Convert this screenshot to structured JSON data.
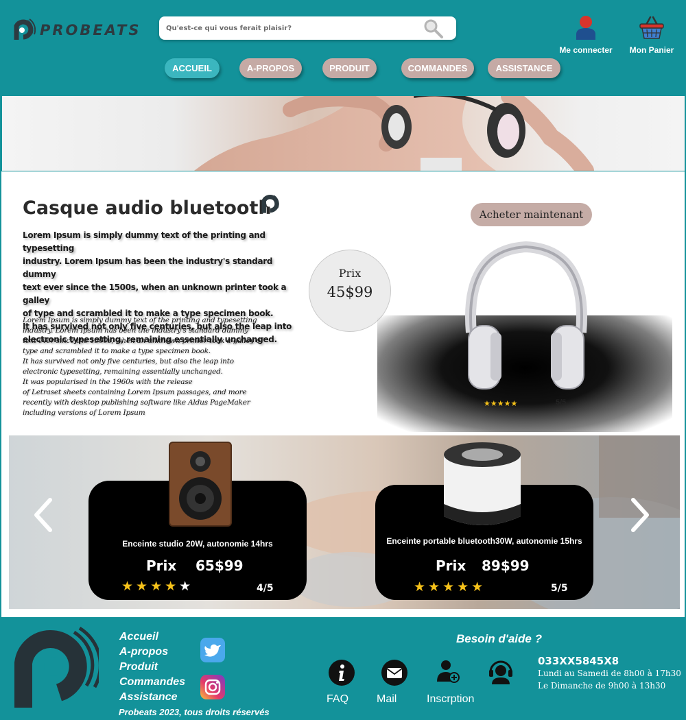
{
  "header": {
    "brand": "PROBEATS",
    "search": {
      "placeholder": "Qu'est-ce qui vous ferait plaisir?"
    },
    "login_label": "Me connecter",
    "cart_label": "Mon Panier"
  },
  "nav": [
    {
      "label": "ACCUEIL",
      "active": true
    },
    {
      "label": "A-PROPOS",
      "active": false
    },
    {
      "label": "PRODUIT",
      "active": false
    },
    {
      "label": "COMMANDES",
      "active": false
    },
    {
      "label": "ASSISTANCE",
      "active": false
    }
  ],
  "product": {
    "title": "Casque audio bluetooth",
    "description_bold": [
      "Lorem Ipsum is simply dummy text of the printing and typesetting",
      " industry. Lorem Ipsum has been the industry's standard dummy",
      "text ever since the 1500s, when an unknown printer took a galley",
      "of type and scrambled it to make a type specimen book.",
      "It has survived not only five centuries, but also the leap into",
      " electronic typesetting, remaining essentially unchanged."
    ],
    "description_italic": [
      "Lorem Ipsum is simply dummy text of the printing and typesetting",
      " industry. Lorem Ipsum has been the industry's standard dummy",
      " text ever since the 1500s, when an unknown printer took a galley of",
      " type and scrambled it to make a type specimen book.",
      " It has survived not only five centuries, but also the leap into",
      "electronic typesetting, remaining essentially unchanged.",
      " It was popularised in the 1960s with the release",
      " of Letraset sheets containing Lorem Ipsum passages, and more",
      " recently with desktop publishing software like Aldus PageMaker",
      "including versions of Lorem Ipsum"
    ],
    "price_label": "Prix",
    "price_value": "45$99",
    "buy_label": "Acheter maintenant",
    "stars": "★★★★★",
    "rating_text": "5/5"
  },
  "carousel": {
    "prev_icon": "chevron-left-icon",
    "next_icon": "chevron-right-icon",
    "cards": [
      {
        "title": "Enceinte studio 20W, autonomie 14hrs",
        "price_label": "Prix",
        "price_value": "65$99",
        "stars_filled": "★★★★",
        "stars_empty": "★",
        "rating_text": "4/5"
      },
      {
        "title": "Enceinte portable bluetooth30W, autonomie 15hrs",
        "price_label": "Prix",
        "price_value": "89$99",
        "stars_filled": "★★★★★",
        "stars_empty": "",
        "rating_text": "5/5"
      }
    ]
  },
  "footer": {
    "links": [
      "Accueil",
      "A-propos",
      "Produit",
      "Commandes",
      "Assistance"
    ],
    "copyright": "Probeats 2023, tous droits réservés",
    "help_title": "Besoin d'aide ?",
    "help_items": [
      {
        "label": "FAQ",
        "icon": "info-icon"
      },
      {
        "label": "Mail",
        "icon": "mail-icon"
      },
      {
        "label": "Inscrption",
        "icon": "add-user-icon"
      },
      {
        "label": "",
        "icon": "support-agent-icon"
      }
    ],
    "phone": "033XX5845X8",
    "hours_weekday": "Lundi au Samedi de 8h00 à 17h30",
    "hours_sunday": "Le Dimanche de 9h00 à 13h30"
  },
  "colors": {
    "teal": "#13929a",
    "nav_button": "#c5aaa5",
    "nav_active": "#3bb6bf",
    "star": "#f6c21a"
  }
}
